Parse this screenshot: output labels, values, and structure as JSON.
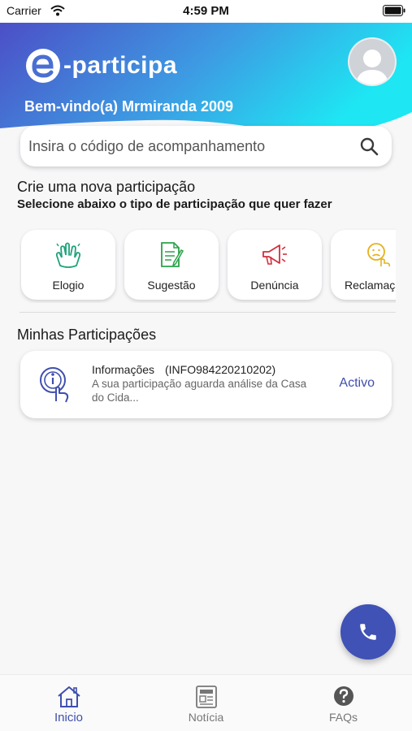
{
  "status_bar": {
    "carrier": "Carrier",
    "time": "4:59 PM"
  },
  "header": {
    "logo_text": "-participa",
    "welcome": "Bem-vindo(a) Mrmiranda 2009"
  },
  "search": {
    "placeholder": "Insira o código de acompanhamento"
  },
  "create": {
    "title": "Crie uma nova participação",
    "subtitle": "Selecione abaixo o tipo de participação que quer fazer",
    "types": [
      {
        "label": "Elogio",
        "icon": "clapping-hands-icon",
        "color": "#1fa37a"
      },
      {
        "label": "Sugestão",
        "icon": "document-pencil-icon",
        "color": "#2aa34a"
      },
      {
        "label": "Denúncia",
        "icon": "megaphone-icon",
        "color": "#d32f3a"
      },
      {
        "label": "Reclamação",
        "icon": "sad-face-hand-icon",
        "color": "#e5b21f"
      }
    ]
  },
  "participations": {
    "title": "Minhas Participações",
    "items": [
      {
        "type": "Informações",
        "code": "(INFO984220210202)",
        "description": "A sua participação aguarda análise da Casa do Cida...",
        "status": "Activo",
        "icon": "info-touch-icon"
      }
    ]
  },
  "fab": {
    "icon": "phone-icon",
    "color": "#4052b5"
  },
  "tabs": [
    {
      "label": "Inicio",
      "icon": "home-icon",
      "active": true
    },
    {
      "label": "Notícia",
      "icon": "newspaper-icon",
      "active": false
    },
    {
      "label": "FAQs",
      "icon": "question-circle-icon",
      "active": false
    }
  ],
  "colors": {
    "accent": "#3f4fae",
    "gradient_start": "#4c4fc8",
    "gradient_end": "#1ee4f2"
  }
}
